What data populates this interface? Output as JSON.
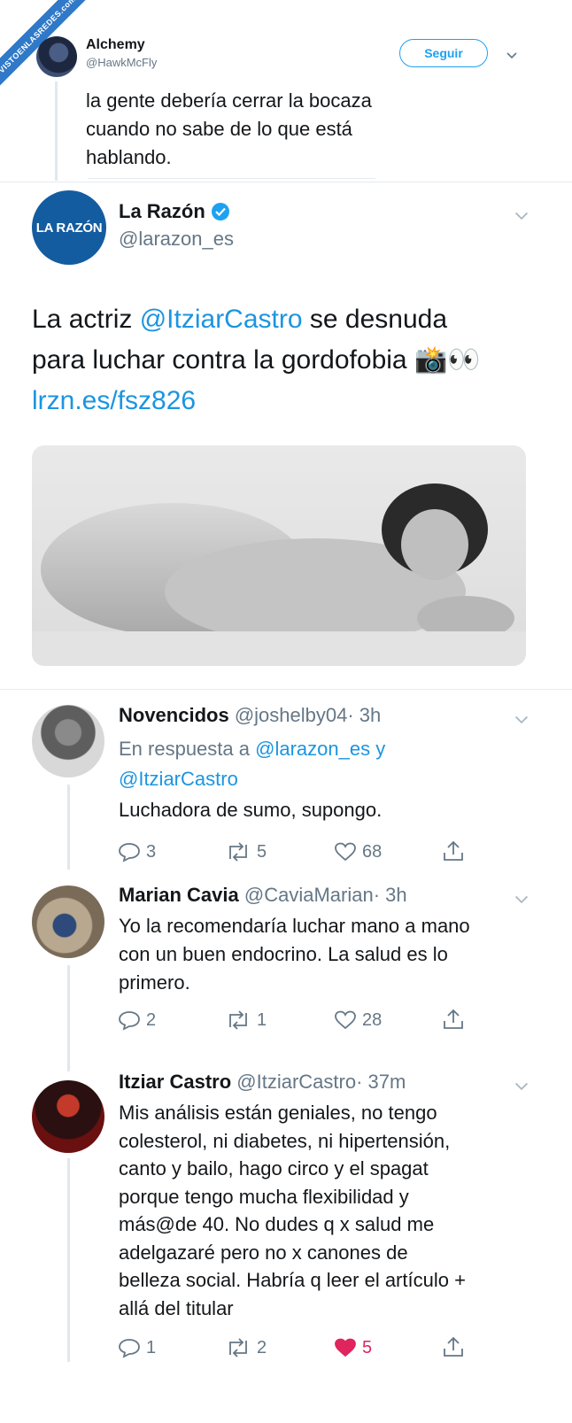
{
  "watermark": "VISTOENLASREDES.com",
  "top_tweet": {
    "name": "Alchemy",
    "handle": "@HawkMcFly",
    "follow_label": "Seguir",
    "text_lines": [
      "la gente debería cerrar la bocaza",
      "cuando no sabe de lo que está",
      "hablando."
    ]
  },
  "main_tweet": {
    "avatar_text": "LA RAZÓN",
    "name": "La Razón",
    "handle": "@larazon_es",
    "line1_pre": "La actriz ",
    "line1_mention": "@ItziarCastro",
    "line1_post": " se desnuda",
    "line2": "para luchar contra la gordofobia 📸👀",
    "link": "lrzn.es/fsz826"
  },
  "replies": [
    {
      "name": "Novencidos",
      "handle": "@joshelby04",
      "time": "· 3h",
      "reply_to_label": "En respuesta a",
      "reply_to_1": "@larazon_es",
      "reply_to_and": "y",
      "reply_to_2": "@ItziarCastro",
      "text_lines": [
        "Luchadora de sumo, supongo."
      ],
      "replies": "3",
      "retweets": "5",
      "likes": "68"
    },
    {
      "name": "Marian Cavia",
      "handle": "@CaviaMarian",
      "time": "· 3h",
      "text_lines": [
        "Yo la recomendaría luchar mano a mano",
        "con un buen endocrino. La salud es lo",
        "primero."
      ],
      "replies": "2",
      "retweets": "1",
      "likes": "28"
    },
    {
      "name": "Itziar Castro",
      "handle": "@ItziarCastro",
      "time": "· 37m",
      "text_lines": [
        "Mis análisis están geniales, no tengo",
        "colesterol, ni diabetes, ni hipertensión,",
        "canto y bailo, hago circo y el spagat",
        "porque tengo mucha flexibilidad y",
        "más@de 40. No dudes q x salud me",
        "adelgazaré pero no x canones de",
        "belleza social. Habría q leer el artículo +",
        "allá del titular"
      ],
      "replies": "1",
      "retweets": "2",
      "likes": "5",
      "liked_color": "#e0245e"
    }
  ]
}
